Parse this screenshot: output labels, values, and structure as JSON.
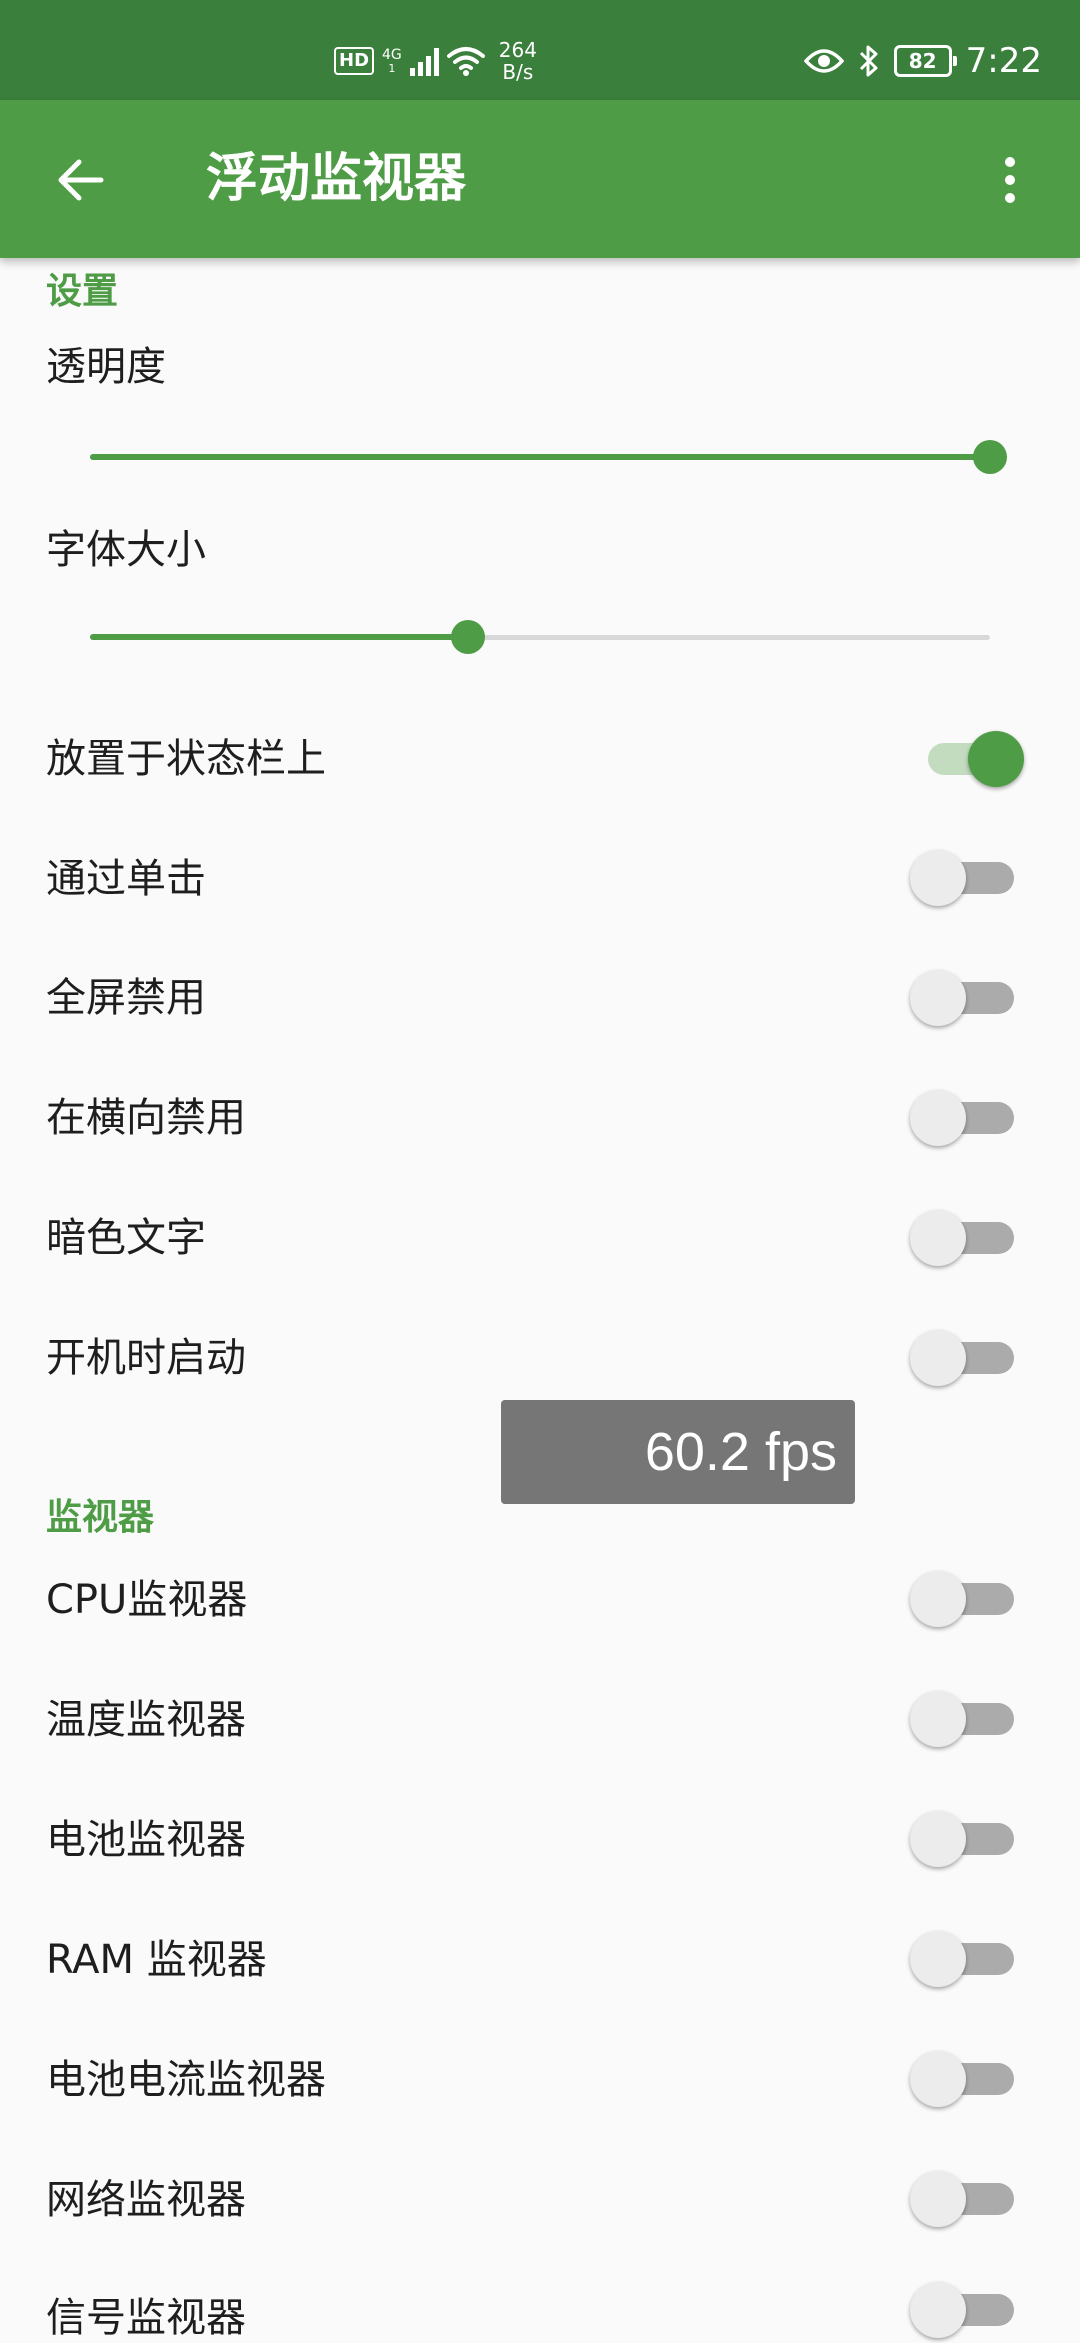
{
  "status_bar": {
    "hd": "HD",
    "network_type": "4G",
    "network_sub": "1",
    "speed_value": "264",
    "speed_unit": "B/s",
    "battery": "82",
    "time": "7:22"
  },
  "app_bar": {
    "title": "浮动监视器"
  },
  "settings": {
    "header": "设置",
    "opacity_label": "透明度",
    "opacity_level": 1.0,
    "font_size_label": "字体大小",
    "font_size_level": 0.42,
    "toggles": [
      {
        "label": "放置于状态栏上",
        "on": true
      },
      {
        "label": "通过单击",
        "on": false
      },
      {
        "label": "全屏禁用",
        "on": false
      },
      {
        "label": "在横向禁用",
        "on": false
      },
      {
        "label": "暗色文字",
        "on": false
      },
      {
        "label": "开机时启动",
        "on": false
      }
    ]
  },
  "monitors": {
    "header": "监视器",
    "toggles": [
      {
        "label": "CPU监视器",
        "on": false
      },
      {
        "label": "温度监视器",
        "on": false
      },
      {
        "label": "电池监视器",
        "on": false
      },
      {
        "label": "RAM 监视器",
        "on": false
      },
      {
        "label": "电池电流监视器",
        "on": false
      },
      {
        "label": "网络监视器",
        "on": false
      },
      {
        "label": "信号监视器",
        "on": false
      }
    ]
  },
  "fps_overlay": "60.2 fps",
  "colors": {
    "accent": "#4e9c46",
    "status_bar": "#3a7f3c"
  }
}
